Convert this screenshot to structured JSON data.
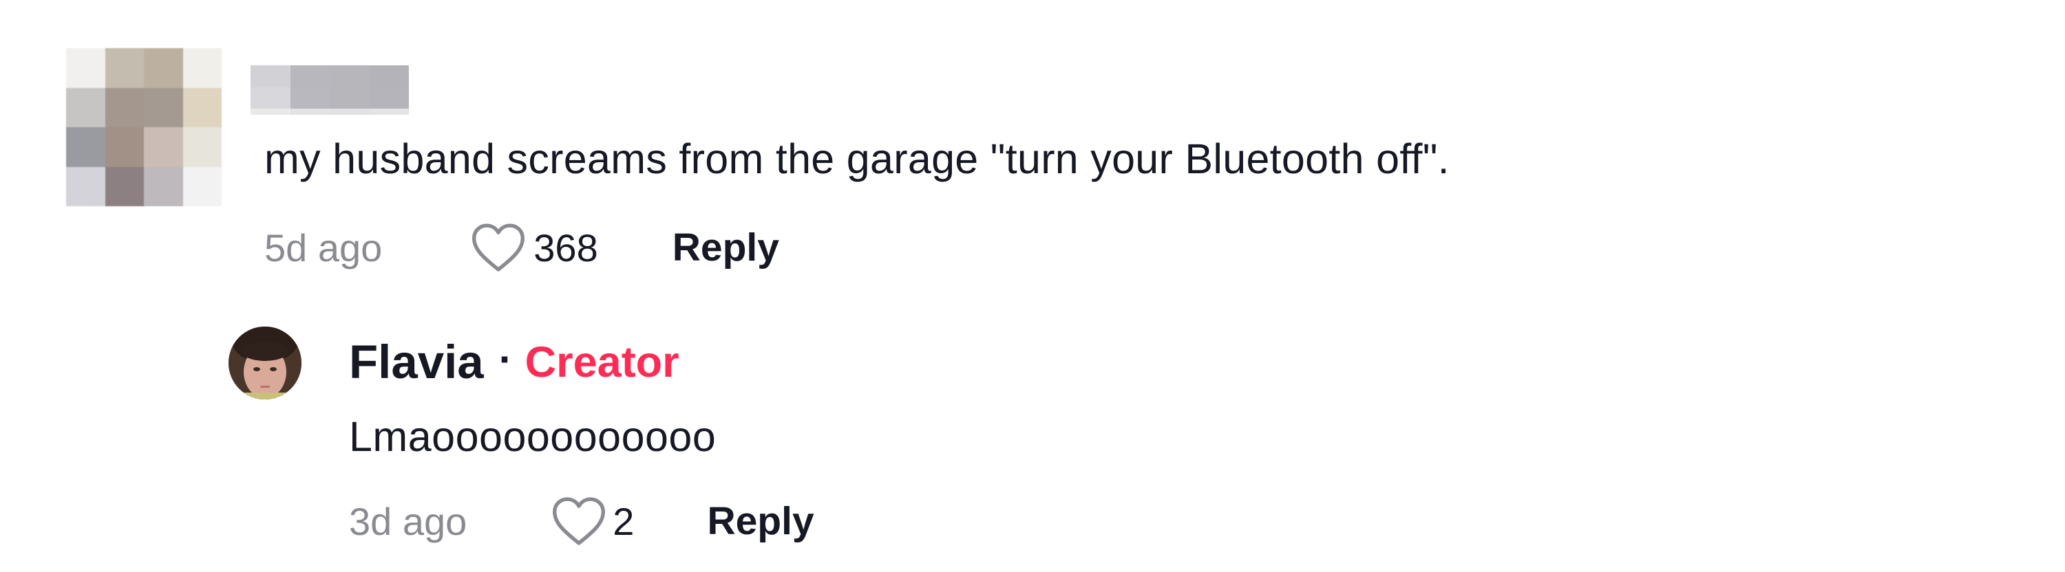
{
  "comment": {
    "text": "my husband screams from the garage \"turn your Bluetooth off\".",
    "time": "5d ago",
    "likes": "368",
    "reply_label": "Reply",
    "avatar_colors": [
      "#f1f0ee",
      "#c4bdaf",
      "#bcb1a1",
      "#f0efea",
      "#c7c5c4",
      "#a4978d",
      "#a59a91",
      "#dfd4bf",
      "#9a9ba0",
      "#a19186",
      "#cbbdb5",
      "#e7e4dc",
      "#d4d3da",
      "#8d8083",
      "#bdb9bc",
      "#f3f2f2"
    ],
    "username_blur_colors": [
      "#d2d2d6",
      "#b8b7bd",
      "#b7b6bb",
      "#b4b3b9",
      "#d8d7db",
      "#b9b8be",
      "#b7b6bb",
      "#b5b4ba",
      "#e9e9ea",
      "#e3e3e5",
      "#e2e2e4",
      "#e4e4e6"
    ]
  },
  "reply": {
    "name": "Flavia",
    "separator": "·",
    "badge": "Creator",
    "text": "Lmaoooooooooooo",
    "time": "3d ago",
    "likes": "2",
    "reply_label": "Reply"
  },
  "colors": {
    "text_primary": "#161823",
    "text_secondary": "#8a8b91",
    "creator_accent": "#fe2c55"
  }
}
